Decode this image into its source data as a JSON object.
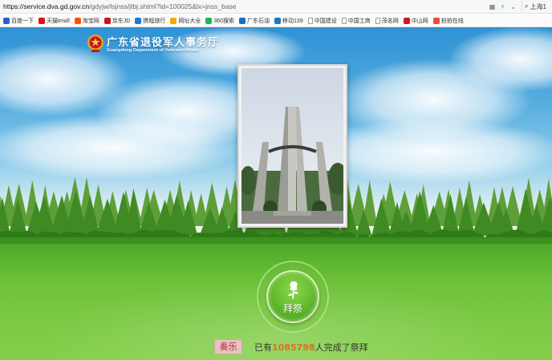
{
  "browser": {
    "url_host": "https://service.dva.gd.gov.cn",
    "url_rest": "/gdyjw/lsjnss/jtbj.shtml?id=100025&lx=jnss_base",
    "search_text": "上海1"
  },
  "bookmarks": [
    {
      "label": "百度一下",
      "color": "#2a5bd7"
    },
    {
      "label": "天猫tmall",
      "color": "#d4171c"
    },
    {
      "label": "淘宝网",
      "color": "#ff5000"
    },
    {
      "label": "京东JD",
      "color": "#c91623"
    },
    {
      "label": "携程旅行",
      "color": "#1a7ad8"
    },
    {
      "label": "网址大全",
      "color": "#f5a700"
    },
    {
      "label": "360搜索",
      "color": "#19b955"
    },
    {
      "label": "广东石油",
      "color": "#1a6ec0"
    },
    {
      "label": "移动139",
      "color": "#1877c9"
    },
    {
      "label": "中国建设",
      "color": "#777777"
    },
    {
      "label": "中国工商",
      "color": "#777777"
    },
    {
      "label": "茂名网",
      "color": "#777777"
    },
    {
      "label": "中山网",
      "color": "#c81c1c"
    },
    {
      "label": "拍拍在线",
      "color": "#e94b3c"
    }
  ],
  "header": {
    "title": "广东省退役军人事务厅",
    "subtitle": "Guangdong Department of Veterans Affairs"
  },
  "memorial": {
    "image": "monument-photo"
  },
  "actions": {
    "pray_label": "拜祭",
    "music_label": "奏乐"
  },
  "counter": {
    "prefix": "已有",
    "count": "1085798",
    "suffix": "人完成了祭拜"
  }
}
